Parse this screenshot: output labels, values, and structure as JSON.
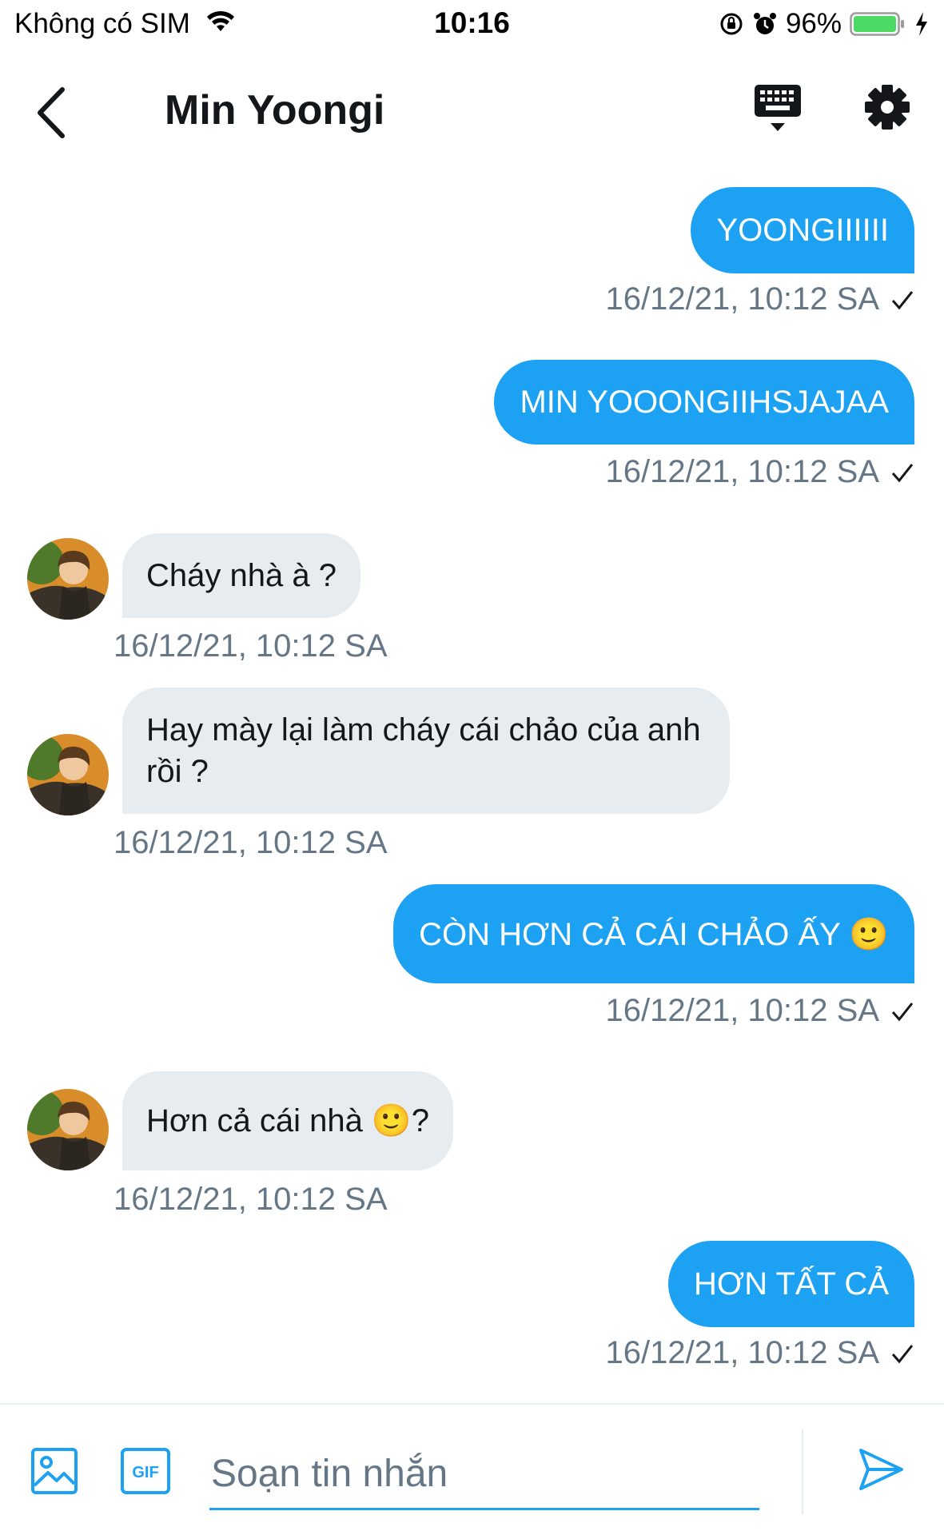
{
  "status_bar": {
    "carrier": "Không có SIM",
    "time": "10:16",
    "battery_pct": "96%"
  },
  "header": {
    "title": "Min Yoongi"
  },
  "messages": [
    {
      "direction": "out",
      "text": "YOONGIIIIII",
      "timestamp": "16/12/21, 10:12 SA"
    },
    {
      "direction": "out",
      "text": "MIN YOOONGIIHSJAJAA",
      "timestamp": "16/12/21, 10:12 SA"
    },
    {
      "direction": "in",
      "text": "Cháy nhà à ?",
      "timestamp": "16/12/21, 10:12 SA"
    },
    {
      "direction": "in",
      "text": "Hay mày lại làm cháy cái chảo của anh rồi ?",
      "timestamp": "16/12/21, 10:12 SA"
    },
    {
      "direction": "out",
      "text": "CÒN HƠN CẢ CÁI CHẢO ẤY 🙂",
      "timestamp": "16/12/21, 10:12 SA"
    },
    {
      "direction": "in",
      "text": "Hơn cả cái nhà 🙂?",
      "timestamp": "16/12/21, 10:12 SA"
    },
    {
      "direction": "out",
      "text": "HƠN TẤT CẢ",
      "timestamp": "16/12/21, 10:12 SA"
    }
  ],
  "composer": {
    "placeholder": "Soạn tin nhắn"
  },
  "colors": {
    "accent": "#1da1f2",
    "incoming_bubble": "#e6ecf0",
    "timestamp": "#657786",
    "battery": "#4cd964"
  },
  "icons": {
    "back": "chevron-left-icon",
    "keyboard": "keyboard-icon",
    "settings": "gear-icon",
    "media": "image-icon",
    "gif": "gif-icon",
    "send": "send-icon"
  }
}
